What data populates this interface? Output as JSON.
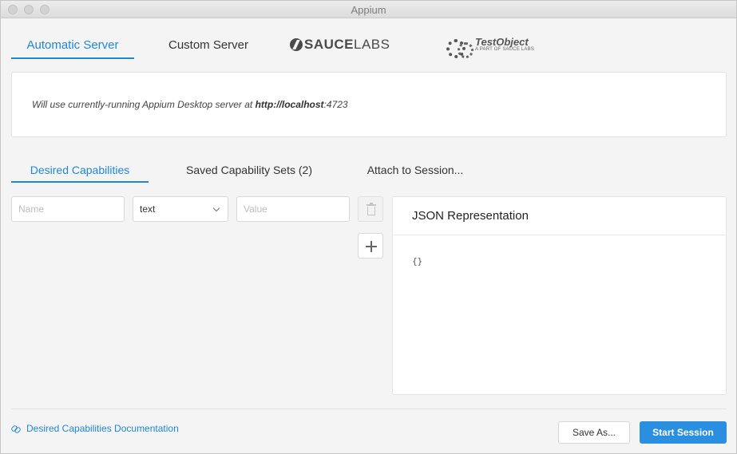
{
  "window": {
    "title": "Appium"
  },
  "server_tabs": {
    "automatic": "Automatic Server",
    "custom": "Custom Server",
    "saucelabs_bold": "SAUCE",
    "saucelabs_light": "LABS",
    "testobject_name": "TestObject",
    "testobject_tagline": "A PART OF SAUCE LABS"
  },
  "info": {
    "message_prefix": "Will use currently-running Appium Desktop server at ",
    "url_host": "http://localhost",
    "url_port": ":4723"
  },
  "cap_tabs": {
    "desired": "Desired Capabilities",
    "saved": "Saved Capability Sets (2)",
    "attach": "Attach to Session..."
  },
  "capability_row": {
    "name_placeholder": "Name",
    "type_value": "text",
    "value_placeholder": "Value"
  },
  "json_panel": {
    "title": "JSON Representation",
    "content": "{}"
  },
  "footer": {
    "doc_link": "Desired Capabilities Documentation",
    "save_as": "Save As...",
    "start_session": "Start Session"
  },
  "colors": {
    "accent": "#1e87d8",
    "primary_button": "#2b8fe1"
  }
}
